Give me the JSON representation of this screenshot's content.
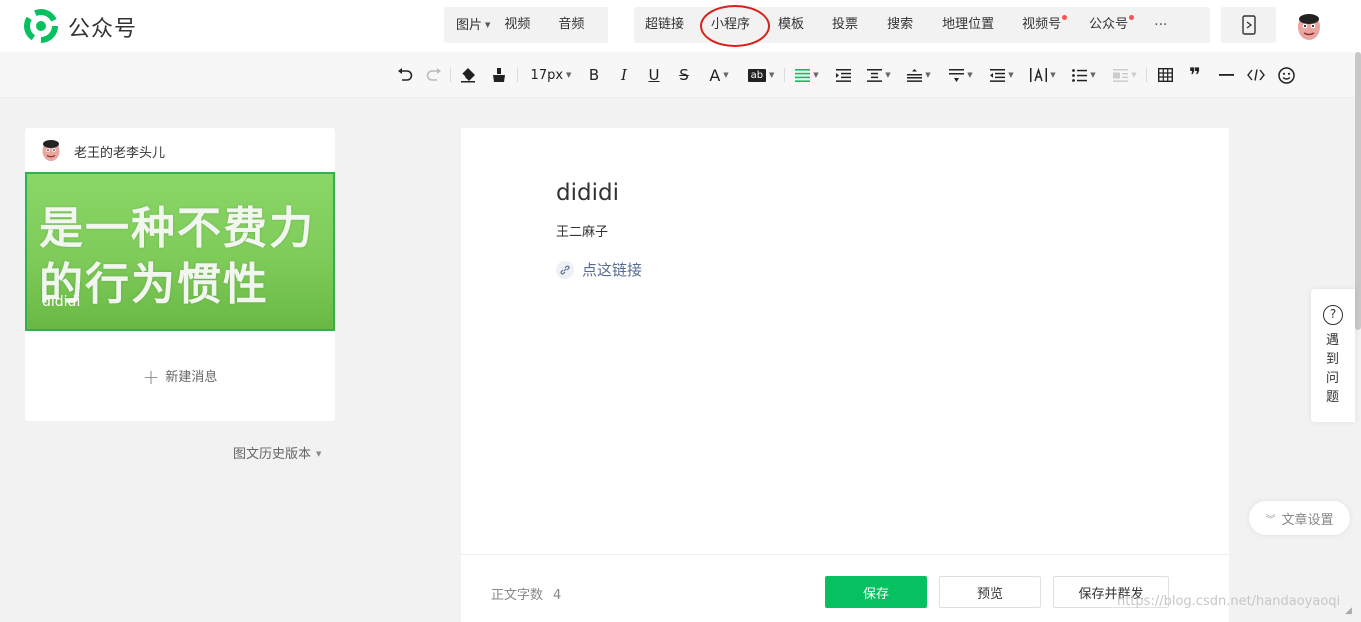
{
  "brand": {
    "name": "公众号"
  },
  "topbar": {
    "media": [
      {
        "label": "图片",
        "caret": true
      },
      {
        "label": "视频"
      },
      {
        "label": "音频"
      }
    ],
    "insert": [
      {
        "label": "超链接"
      },
      {
        "label": "小程序",
        "highlighted": true
      },
      {
        "label": "模板"
      },
      {
        "label": "投票"
      },
      {
        "label": "搜索"
      },
      {
        "label": "地理位置"
      },
      {
        "label": "视频号",
        "dot": true
      },
      {
        "label": "公众号",
        "dot": true
      }
    ],
    "more": "···"
  },
  "format_toolbar": {
    "font_size": "17px",
    "bold": "B",
    "italic": "I",
    "underline": "U",
    "strike": "S",
    "font_color": "A",
    "bg_color": "ab",
    "blockquote": "❞"
  },
  "left_panel": {
    "author": "老王的老李头儿",
    "cover_text_line1": "是一种不费力",
    "cover_text_line2": "的行为惯性",
    "cover_title": "dididi",
    "new_message": "新建消息",
    "history": "图文历史版本"
  },
  "editor": {
    "title": "dididi",
    "author": "王二麻子",
    "link_text": "点这链接",
    "word_count_label": "正文字数",
    "word_count": "4"
  },
  "buttons": {
    "save": "保存",
    "preview": "预览",
    "save_send": "保存并群发"
  },
  "help": {
    "label": "遇到问题"
  },
  "article_settings": "文章设置",
  "watermark": "https://blog.csdn.net/handaoyaoqi",
  "colors": {
    "accent": "#07c160",
    "link": "#576b95",
    "annotation": "#d9201b"
  }
}
